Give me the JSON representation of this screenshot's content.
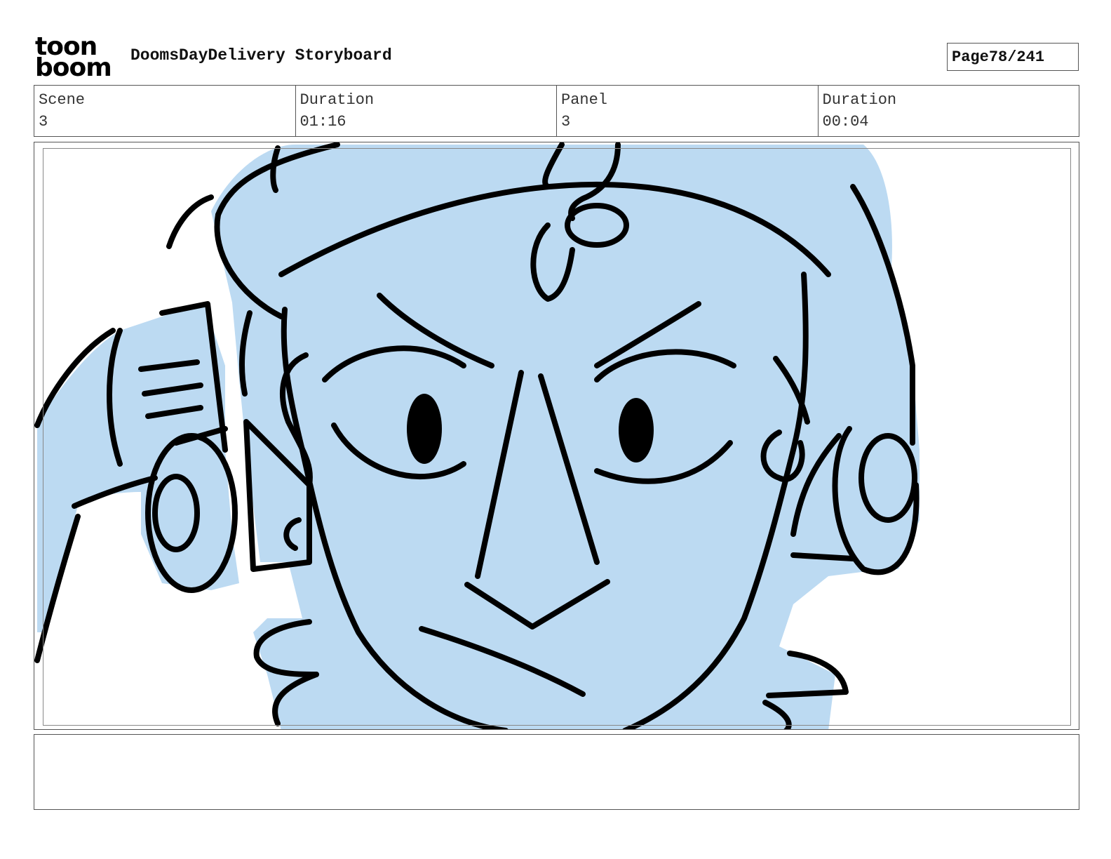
{
  "header": {
    "logo_line1": "toon",
    "logo_line2": "boom",
    "title": "DoomsDayDelivery Storyboard",
    "page_label": "Page",
    "page_value": "78/241"
  },
  "info": {
    "scene_label": "Scene",
    "scene_value": "3",
    "duration_label": "Duration",
    "duration_value": "01:16",
    "panel_label": "Panel",
    "panel_value": "3",
    "panel_duration_label": "Duration",
    "panel_duration_value": "00:04"
  },
  "panel": {
    "fill_color": "#bcdaf2",
    "line_color": "#000000"
  },
  "notes": {
    "text": ""
  }
}
